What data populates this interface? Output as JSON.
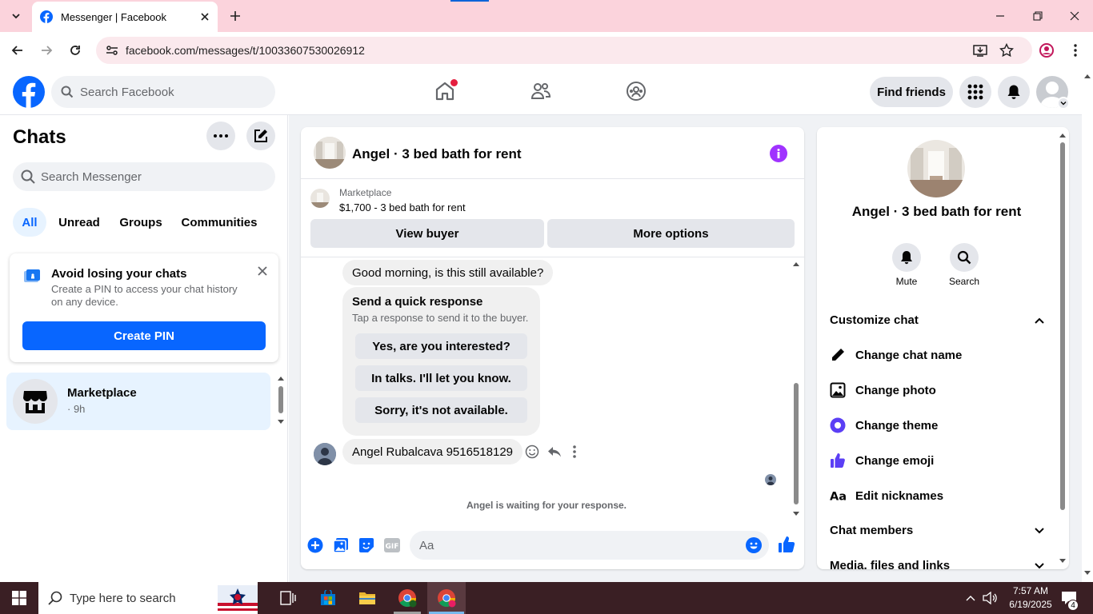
{
  "browser": {
    "tab_title": "Messenger | Facebook",
    "url": "facebook.com/messages/t/10033607530026912"
  },
  "fb": {
    "search_placeholder": "Search Facebook",
    "find_friends": "Find friends"
  },
  "chats": {
    "heading": "Chats",
    "search_placeholder": "Search Messenger",
    "filters": [
      "All",
      "Unread",
      "Groups",
      "Communities"
    ],
    "pin_card": {
      "title": "Avoid losing your chats",
      "text": "Create a PIN to access your chat history on any device.",
      "button": "Create PIN"
    },
    "list": [
      {
        "name": "Marketplace",
        "meta": "· 9h"
      }
    ]
  },
  "conversation": {
    "title": "Angel · 3 bed bath for rent",
    "listing_source": "Marketplace",
    "listing_title": "$1,700 - 3 bed bath for rent",
    "view_buyer": "View buyer",
    "more_options": "More options",
    "messages": {
      "first": "Good morning, is this still available?",
      "quick_title": "Send a quick response",
      "quick_sub": "Tap a response to send it to the buyer.",
      "quick_responses": [
        "Yes, are you interested?",
        "In talks. I'll let you know.",
        "Sorry, it's not available."
      ],
      "last": "Angel Rubalcava 9516518129"
    },
    "waiting": "Angel is waiting for your response.",
    "input_placeholder": "Aa"
  },
  "info": {
    "title": "Angel · 3 bed bath for rent",
    "mute": "Mute",
    "search": "Search",
    "customize": "Customize chat",
    "items": [
      "Change chat name",
      "Change photo",
      "Change theme",
      "Change emoji",
      "Edit nicknames"
    ],
    "members": "Chat members",
    "media": "Media, files and links"
  },
  "taskbar": {
    "search_placeholder": "Type here to search",
    "time": "7:57 AM",
    "date": "6/19/2025",
    "notif_count": "4"
  },
  "colors": {
    "fb_blue": "#0866ff",
    "tab_pink": "#fbd3dc",
    "theme_purple": "#a033ff",
    "taskbar": "#3a1f24"
  }
}
